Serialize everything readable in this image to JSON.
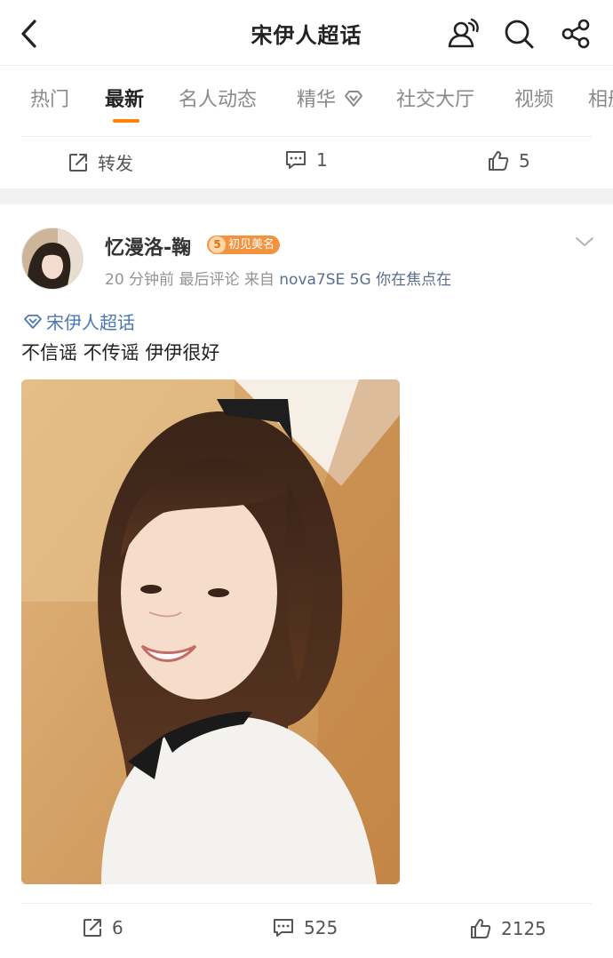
{
  "header": {
    "title": "宋伊人超话",
    "icons": [
      "back-icon",
      "people-icon",
      "search-icon",
      "share-icon"
    ]
  },
  "tabs": [
    {
      "label": "热门"
    },
    {
      "label": "最新"
    },
    {
      "label": "名人动态"
    },
    {
      "label": "精华"
    },
    {
      "label": "社交大厅"
    },
    {
      "label": "视频"
    },
    {
      "label": "相册"
    }
  ],
  "active_tab": "最新",
  "prev_post": {
    "repost_label": "转发",
    "comments": "1",
    "likes": "5"
  },
  "post": {
    "username": "忆漫洛-鞠",
    "badge_level": "5",
    "badge_text": "初见美名",
    "time": "20 分钟前",
    "last_comment": "最后评论",
    "source_prefix": "来自",
    "source": "nova7SE 5G 你在焦点在",
    "topic": "宋伊人超话",
    "text": "不信谣 不传谣 伊伊很好",
    "reposts": "6",
    "comments": "525",
    "likes": "2125"
  },
  "colors": {
    "accent": "#ff8200",
    "link": "#4a78b5",
    "badge": "#f3923f"
  }
}
